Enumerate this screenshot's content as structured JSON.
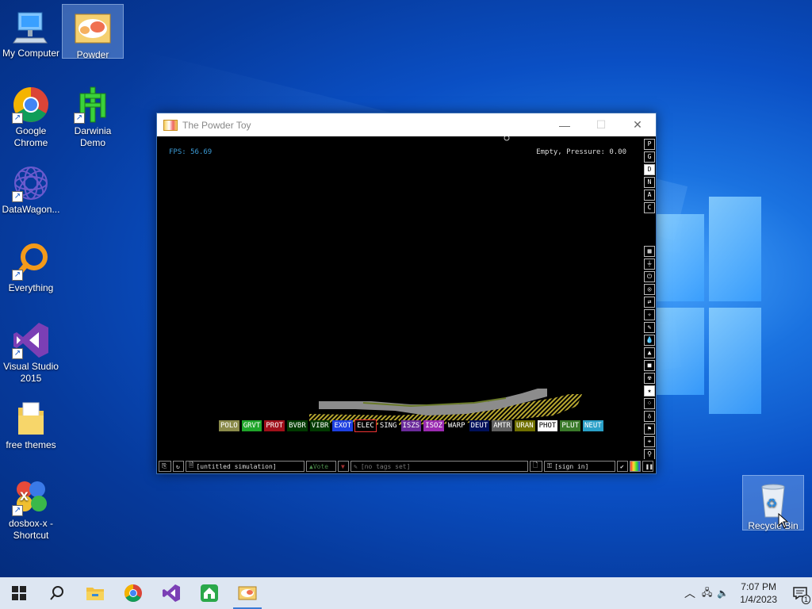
{
  "desktop": {
    "icons": [
      {
        "id": "my-computer",
        "label": "My Computer"
      },
      {
        "id": "powder",
        "label": "Powder"
      },
      {
        "id": "google-chrome",
        "label": "Google Chrome"
      },
      {
        "id": "darwinia-demo",
        "label": "Darwinia Demo"
      },
      {
        "id": "datawagon",
        "label": "DataWagon..."
      },
      {
        "id": "everything",
        "label": "Everything"
      },
      {
        "id": "visual-studio",
        "label": "Visual Studio 2015"
      },
      {
        "id": "free-themes",
        "label": "free themes"
      },
      {
        "id": "dosbox",
        "label": "dosbox-x - Shortcut"
      },
      {
        "id": "recycle-bin",
        "label": "Recycle Bin"
      }
    ]
  },
  "window": {
    "title": "The Powder Toy",
    "fps": "FPS: 56.69",
    "status": "Empty, Pressure: 0.00",
    "mode_buttons": [
      "P",
      "G",
      "D",
      "N",
      "A",
      "C"
    ],
    "elements": [
      {
        "label": "POLO",
        "bg": "#8a8a4a",
        "fg": "#fff"
      },
      {
        "label": "GRVT",
        "bg": "#1fa52a",
        "fg": "#fff"
      },
      {
        "label": "PROT",
        "bg": "#a0101a",
        "fg": "#fff"
      },
      {
        "label": "BVBR",
        "bg": "#003a00",
        "fg": "#fff"
      },
      {
        "label": "VIBR",
        "bg": "#003a00",
        "fg": "#fff"
      },
      {
        "label": "EXOT",
        "bg": "#1d3fe0",
        "fg": "#fff"
      },
      {
        "label": "ELEC",
        "bg": "#000",
        "fg": "#fff"
      },
      {
        "label": "SING",
        "bg": "#000",
        "fg": "#fff"
      },
      {
        "label": "ISZS",
        "bg": "#6a2a9a",
        "fg": "#fff"
      },
      {
        "label": "ISOZ",
        "bg": "#9a2ab0",
        "fg": "#fff"
      },
      {
        "label": "WARP",
        "bg": "#000",
        "fg": "#fff"
      },
      {
        "label": "DEUT",
        "bg": "#00105a",
        "fg": "#fff"
      },
      {
        "label": "AMTR",
        "bg": "#606060",
        "fg": "#fff"
      },
      {
        "label": "URAN",
        "bg": "#707000",
        "fg": "#fff"
      },
      {
        "label": "PHOT",
        "bg": "#fff",
        "fg": "#000"
      },
      {
        "label": "PLUT",
        "bg": "#3a7a2a",
        "fg": "#fff"
      },
      {
        "label": "NEUT",
        "bg": "#2aa0c8",
        "fg": "#fff"
      }
    ],
    "bottom": {
      "sim_name": "[untitled simulation]",
      "vote": "Vote",
      "tags": "[no tags set]",
      "signin": "[sign in]"
    }
  },
  "taskbar": {
    "time": "7:07 PM",
    "date": "1/4/2023",
    "notifications": "1"
  }
}
